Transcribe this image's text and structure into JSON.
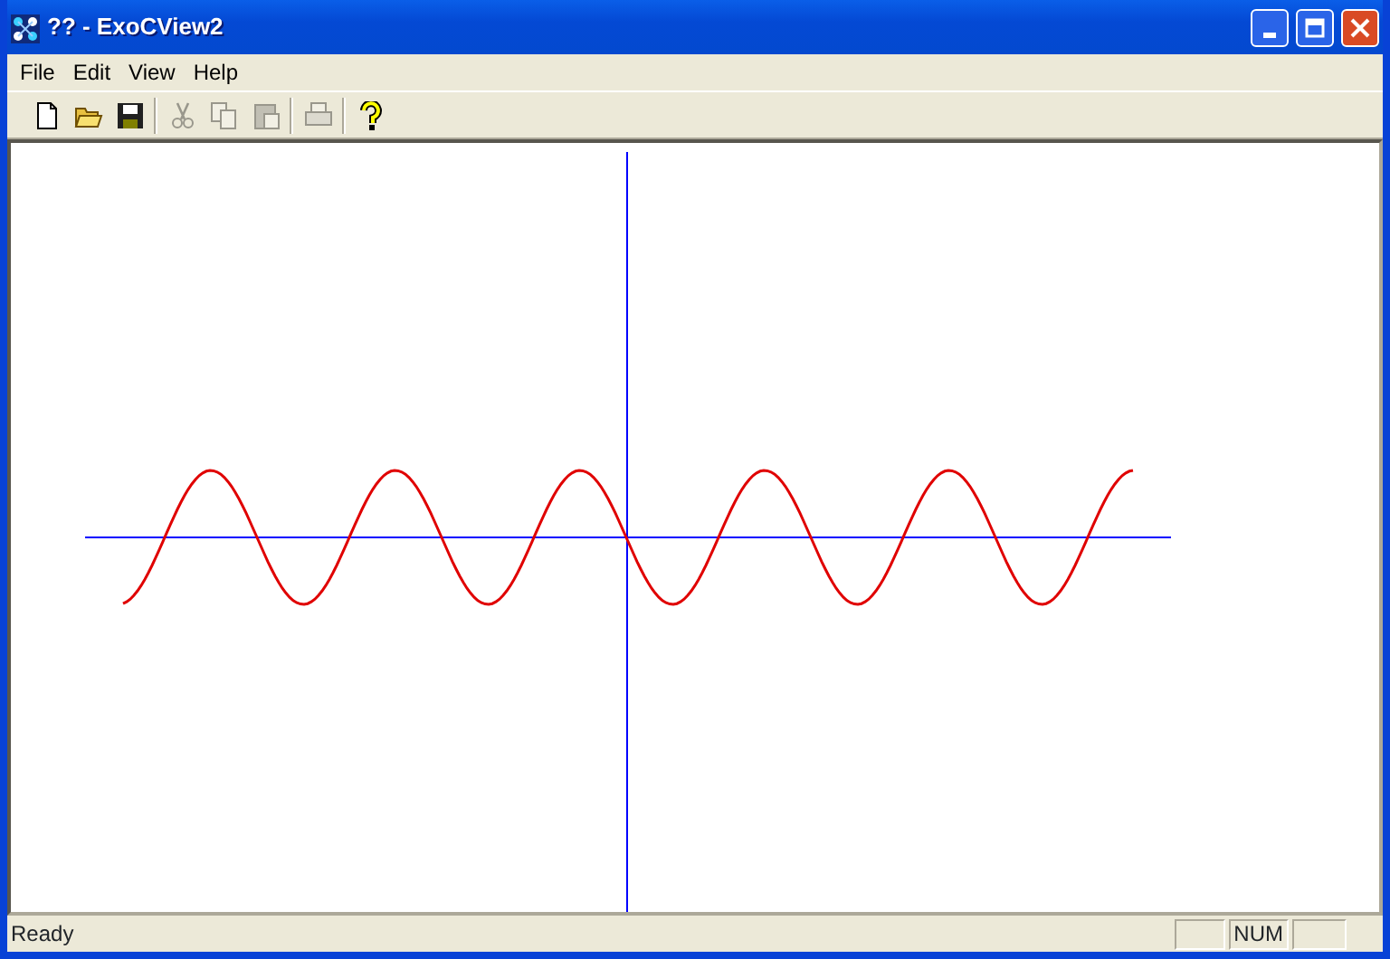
{
  "window": {
    "title": "?? - ExoCView2"
  },
  "menu": [
    "File",
    "Edit",
    "View",
    "Help"
  ],
  "toolbar": [
    {
      "kind": "button",
      "disabled": false
    },
    {
      "kind": "button",
      "disabled": false
    },
    {
      "kind": "button",
      "disabled": false
    },
    {
      "kind": "separator"
    },
    {
      "kind": "button",
      "disabled": true
    },
    {
      "kind": "button",
      "disabled": true
    },
    {
      "kind": "button",
      "disabled": true
    },
    {
      "kind": "separator"
    },
    {
      "kind": "button",
      "disabled": true
    },
    {
      "kind": "separator"
    },
    {
      "kind": "button",
      "disabled": false
    }
  ],
  "view": {
    "kind": "sine-plot"
  },
  "status_bar": {
    "message": "Ready",
    "indicators": [
      "NUM"
    ]
  }
}
